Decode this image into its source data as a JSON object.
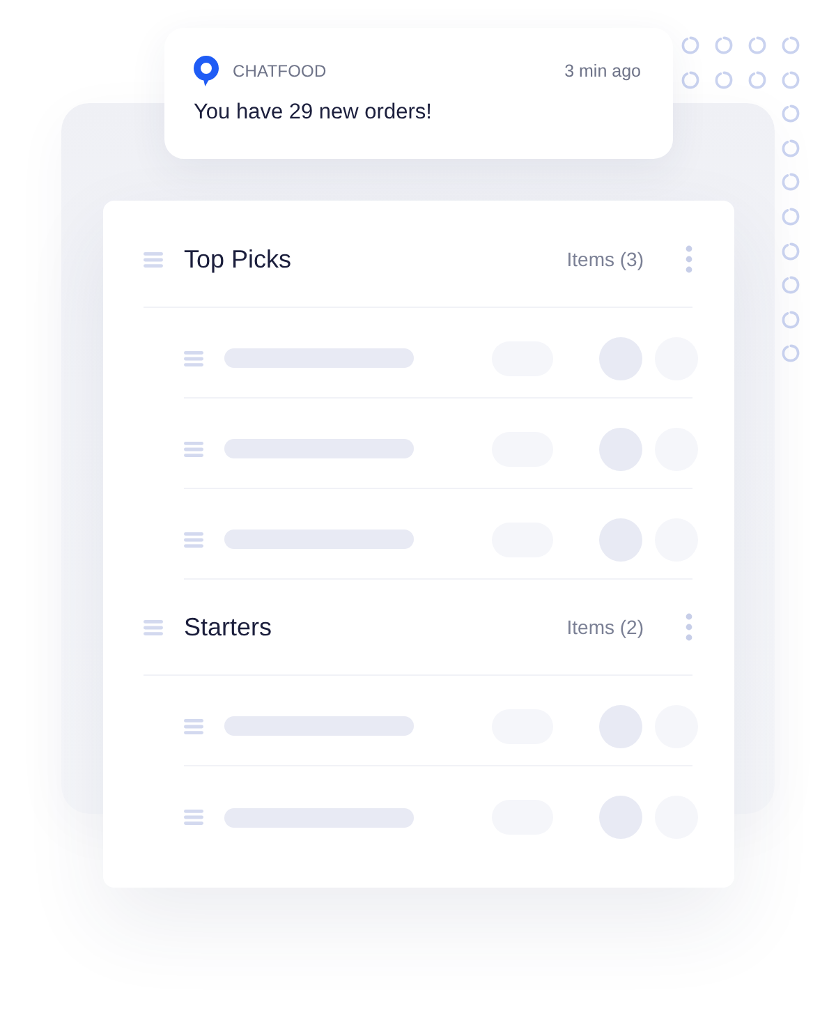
{
  "notification": {
    "app": "CHATFOOD",
    "time": "3 min ago",
    "message": "You have 29 new orders!"
  },
  "sections": [
    {
      "title": "Top Picks",
      "count": "Items (3)",
      "items": [
        {
          "kind": "placeholder"
        },
        {
          "kind": "placeholder"
        },
        {
          "kind": "placeholder"
        }
      ]
    },
    {
      "title": "Starters",
      "count": "Items (2)",
      "items": [
        {
          "kind": "placeholder"
        },
        {
          "kind": "placeholder"
        }
      ]
    }
  ]
}
